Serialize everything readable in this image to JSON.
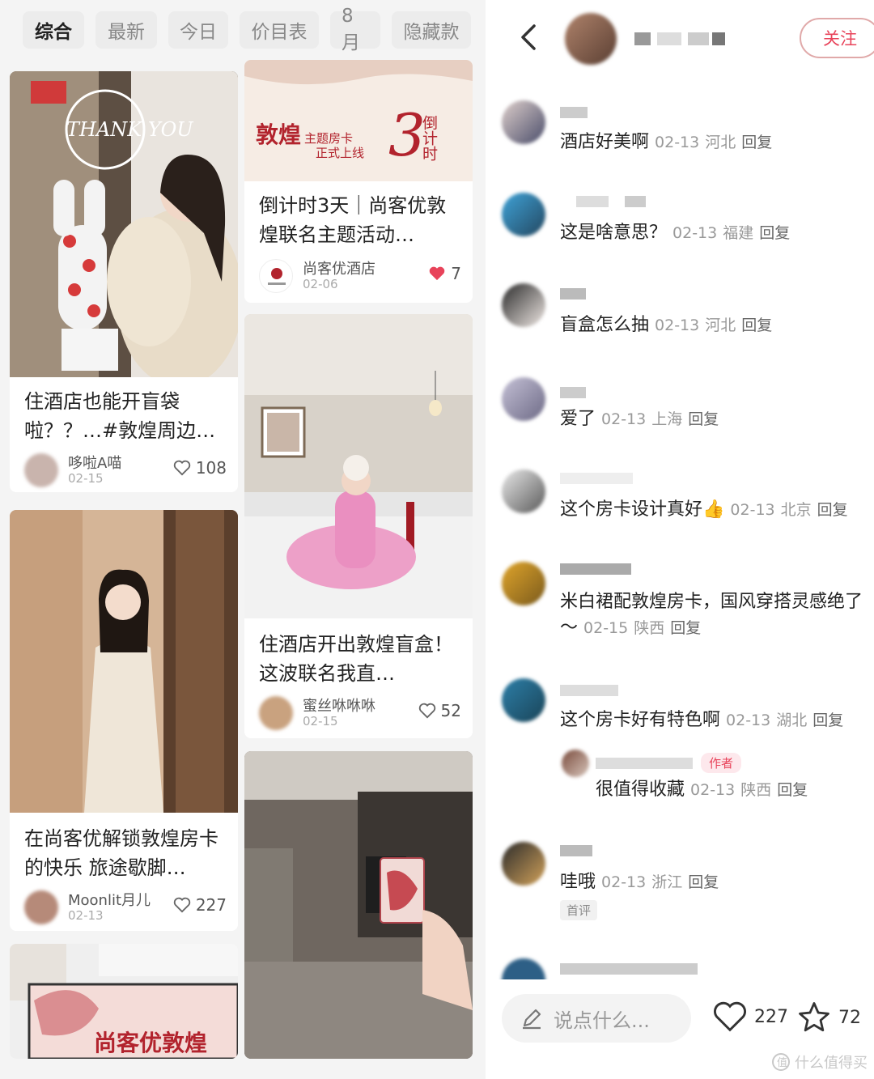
{
  "feed": {
    "tabs": [
      {
        "label": "综合",
        "active": true
      },
      {
        "label": "最新",
        "active": false
      },
      {
        "label": "今日",
        "active": false
      },
      {
        "label": "价目表",
        "active": false
      },
      {
        "label": "8月",
        "active": false
      },
      {
        "label": "隐藏款",
        "active": false
      }
    ],
    "cards": [
      {
        "title": "住酒店也能开盲袋啦？？…#敦煌周边…",
        "author": "哆啦A喵",
        "date": "02-15",
        "likes": "108",
        "liked": false
      },
      {
        "title": "倒计时3天｜尚客优敦煌联名主题活动…",
        "author": "尚客优酒店",
        "date": "02-06",
        "likes": "7",
        "liked": true
      },
      {
        "title": "住酒店开出敦煌盲盒！这波联名我直…",
        "author": "蜜丝咻咻咻",
        "date": "02-15",
        "likes": "52",
        "liked": false
      },
      {
        "title": "在尚客优解锁敦煌房卡的快乐 旅途歇脚…",
        "author": "Moonlit月儿",
        "date": "02-13",
        "likes": "227",
        "liked": false
      }
    ],
    "poster": {
      "heading": "敦煌",
      "subtitle1": "主题房卡",
      "subtitle2": "正式上线",
      "number": "3",
      "countdown": "倒计时",
      "brand": "尚客优敦煌"
    },
    "card1_image_text": "THANK YOU"
  },
  "detail": {
    "follow_label": "关注",
    "comments": [
      {
        "text": "酒店好美啊",
        "date": "02-13",
        "region": "河北",
        "reply": "回复",
        "tag": ""
      },
      {
        "text": "这是啥意思？",
        "date": "02-13",
        "region": "福建",
        "reply": "回复",
        "tag": ""
      },
      {
        "text": "盲盒怎么抽",
        "date": "02-13",
        "region": "河北",
        "reply": "回复",
        "tag": ""
      },
      {
        "text": "爱了",
        "date": "02-13",
        "region": "上海",
        "reply": "回复",
        "tag": ""
      },
      {
        "text": "这个房卡设计真好👍",
        "date": "02-13",
        "region": "北京",
        "reply": "回复",
        "tag": ""
      },
      {
        "text": "米白裙配敦煌房卡，国风穿搭灵感绝了～",
        "date": "02-15",
        "region": "陕西",
        "reply": "回复",
        "tag": ""
      },
      {
        "text": "这个房卡好有特色啊",
        "date": "02-13",
        "region": "湖北",
        "reply": "回复",
        "tag": ""
      },
      {
        "text": "哇哦",
        "date": "02-13",
        "region": "浙江",
        "reply": "回复",
        "tag": "首评"
      }
    ],
    "sub_reply": {
      "author_tag": "作者",
      "text": "很值得收藏",
      "date": "02-13",
      "region": "陕西",
      "reply": "回复"
    },
    "bottom": {
      "placeholder": "说点什么...",
      "likes": "227",
      "stars": "72"
    },
    "watermark": "什么值得买",
    "colors": {
      "accent": "#e8435a"
    }
  }
}
